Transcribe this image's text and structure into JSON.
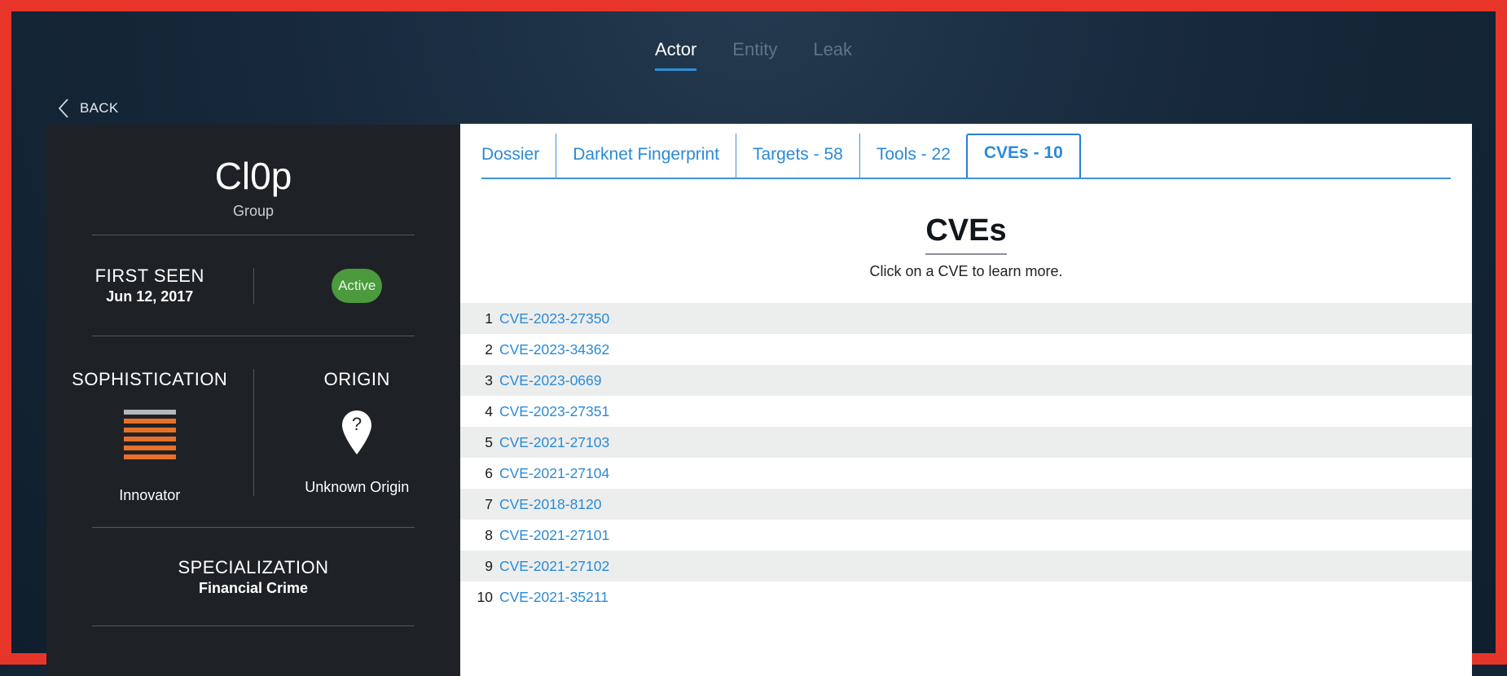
{
  "top_nav": {
    "tabs": [
      "Actor",
      "Entity",
      "Leak"
    ],
    "active": "Actor"
  },
  "back_label": "BACK",
  "profile": {
    "name": "Cl0p",
    "type": "Group",
    "first_seen_label": "FIRST SEEN",
    "first_seen": "Jun 12, 2017",
    "status": "Active",
    "sophistication_label": "SOPHISTICATION",
    "sophistication": "Innovator",
    "sophistication_level": {
      "filled": 5,
      "total": 6
    },
    "origin_label": "ORIGIN",
    "origin": "Unknown Origin",
    "specialization_label": "SPECIALIZATION",
    "specialization": "Financial Crime"
  },
  "detail_tabs": [
    "Dossier",
    "Darknet Fingerprint",
    "Targets - 58",
    "Tools - 22",
    "CVEs - 10"
  ],
  "active_tab": "CVEs - 10",
  "cves": {
    "title": "CVEs",
    "subtitle": "Click on a CVE to learn more.",
    "items": [
      {
        "n": "1",
        "id": "CVE-2023-27350"
      },
      {
        "n": "2",
        "id": "CVE-2023-34362"
      },
      {
        "n": "3",
        "id": "CVE-2023-0669"
      },
      {
        "n": "4",
        "id": "CVE-2023-27351"
      },
      {
        "n": "5",
        "id": "CVE-2021-27103"
      },
      {
        "n": "6",
        "id": "CVE-2021-27104"
      },
      {
        "n": "7",
        "id": "CVE-2018-8120"
      },
      {
        "n": "8",
        "id": "CVE-2021-27101"
      },
      {
        "n": "9",
        "id": "CVE-2021-27102"
      },
      {
        "n": "10",
        "id": "CVE-2021-35211"
      }
    ]
  },
  "colors": {
    "frame": "#e8352a",
    "accent": "#2b8ad6",
    "active_badge": "#4b9a3e",
    "sophistication_bar": "#e8702a"
  }
}
